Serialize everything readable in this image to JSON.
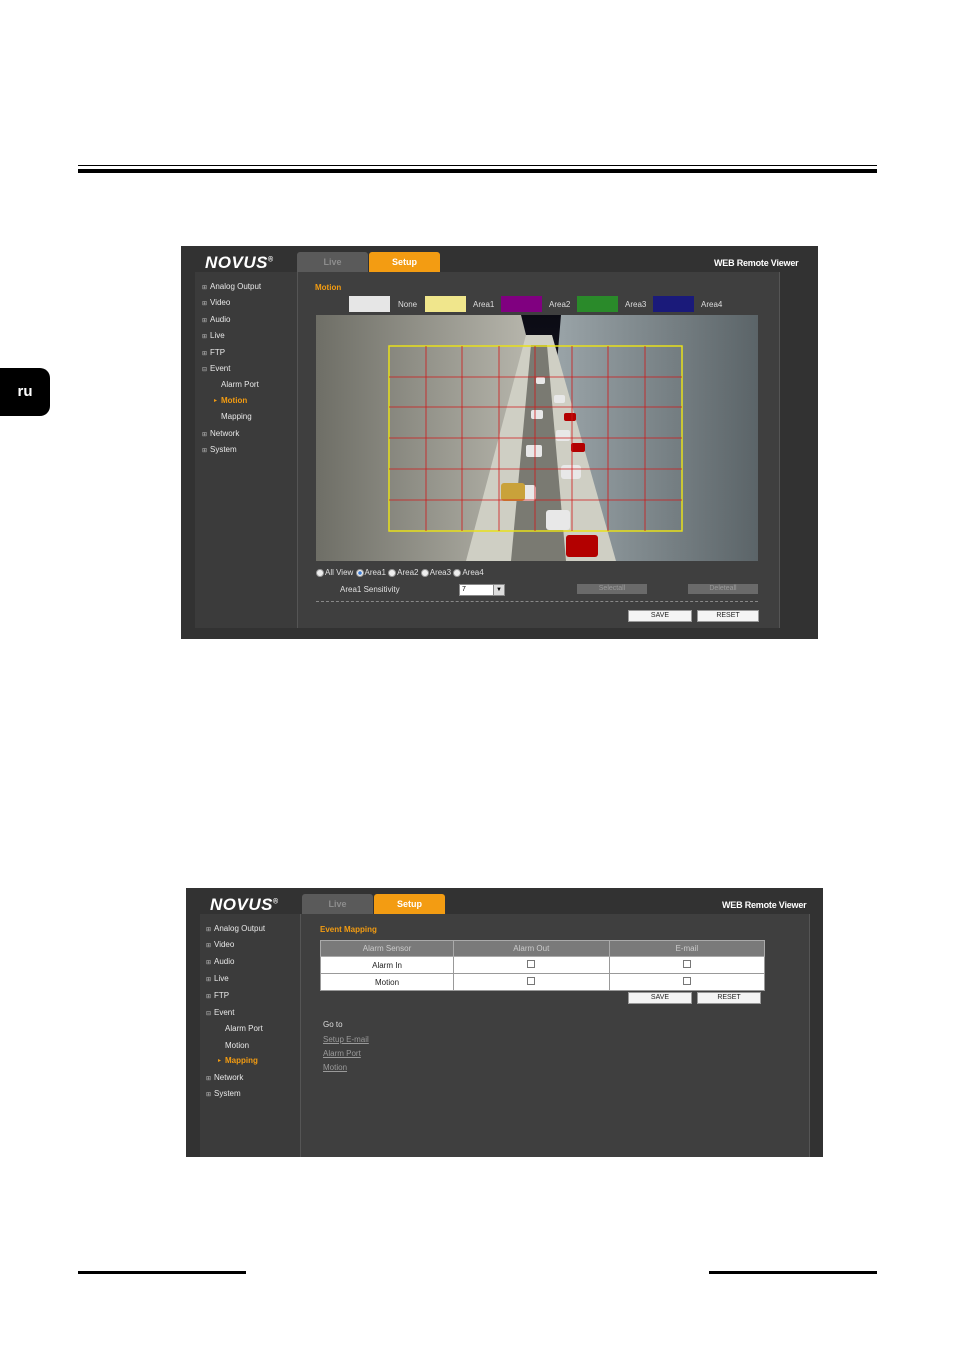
{
  "page": {
    "lang_tab": "ru"
  },
  "shot1": {
    "brand": "NOVUS",
    "brand_mark": "®",
    "tabs": {
      "live": "Live",
      "setup": "Setup"
    },
    "viewer_title": "WEB Remote Viewer",
    "menu": [
      "Analog Output",
      "Video",
      "Audio",
      "Live",
      "FTP",
      "Event"
    ],
    "submenu": [
      "Alarm Port",
      "Motion",
      "Mapping"
    ],
    "menu_after": [
      "Network",
      "System"
    ],
    "section_title": "Motion",
    "swatches": [
      {
        "label": "None",
        "color": "#e6e6e6"
      },
      {
        "label": "Area1",
        "color": "#f0e68c"
      },
      {
        "label": "Area2",
        "color": "#800080"
      },
      {
        "label": "Area3",
        "color": "#2a8a2a"
      },
      {
        "label": "Area4",
        "color": "#1a1a7a"
      }
    ],
    "view_options": [
      "All View",
      "Area1",
      "Area2",
      "Area3",
      "Area4"
    ],
    "sensitivity_label": "Area1 Sensitivity",
    "sensitivity_value": "7",
    "select_all": "Selectall",
    "delete_all": "Deleteall",
    "save": "SAVE",
    "reset": "RESET"
  },
  "shot2": {
    "brand": "NOVUS",
    "brand_mark": "®",
    "tabs": {
      "live": "Live",
      "setup": "Setup"
    },
    "viewer_title": "WEB Remote Viewer",
    "menu": [
      "Analog Output",
      "Video",
      "Audio",
      "Live",
      "FTP",
      "Event"
    ],
    "submenu": [
      "Alarm Port",
      "Motion",
      "Mapping"
    ],
    "menu_after": [
      "Network",
      "System"
    ],
    "section_title": "Event Mapping",
    "table": {
      "headers": [
        "Alarm Sensor",
        "Alarm Out",
        "E-mail"
      ],
      "rows": [
        "Alarm In",
        "Motion"
      ]
    },
    "save": "SAVE",
    "reset": "RESET",
    "goto_label": "Go to",
    "links": [
      "Setup E-mail",
      "Alarm Port",
      "Motion"
    ]
  }
}
